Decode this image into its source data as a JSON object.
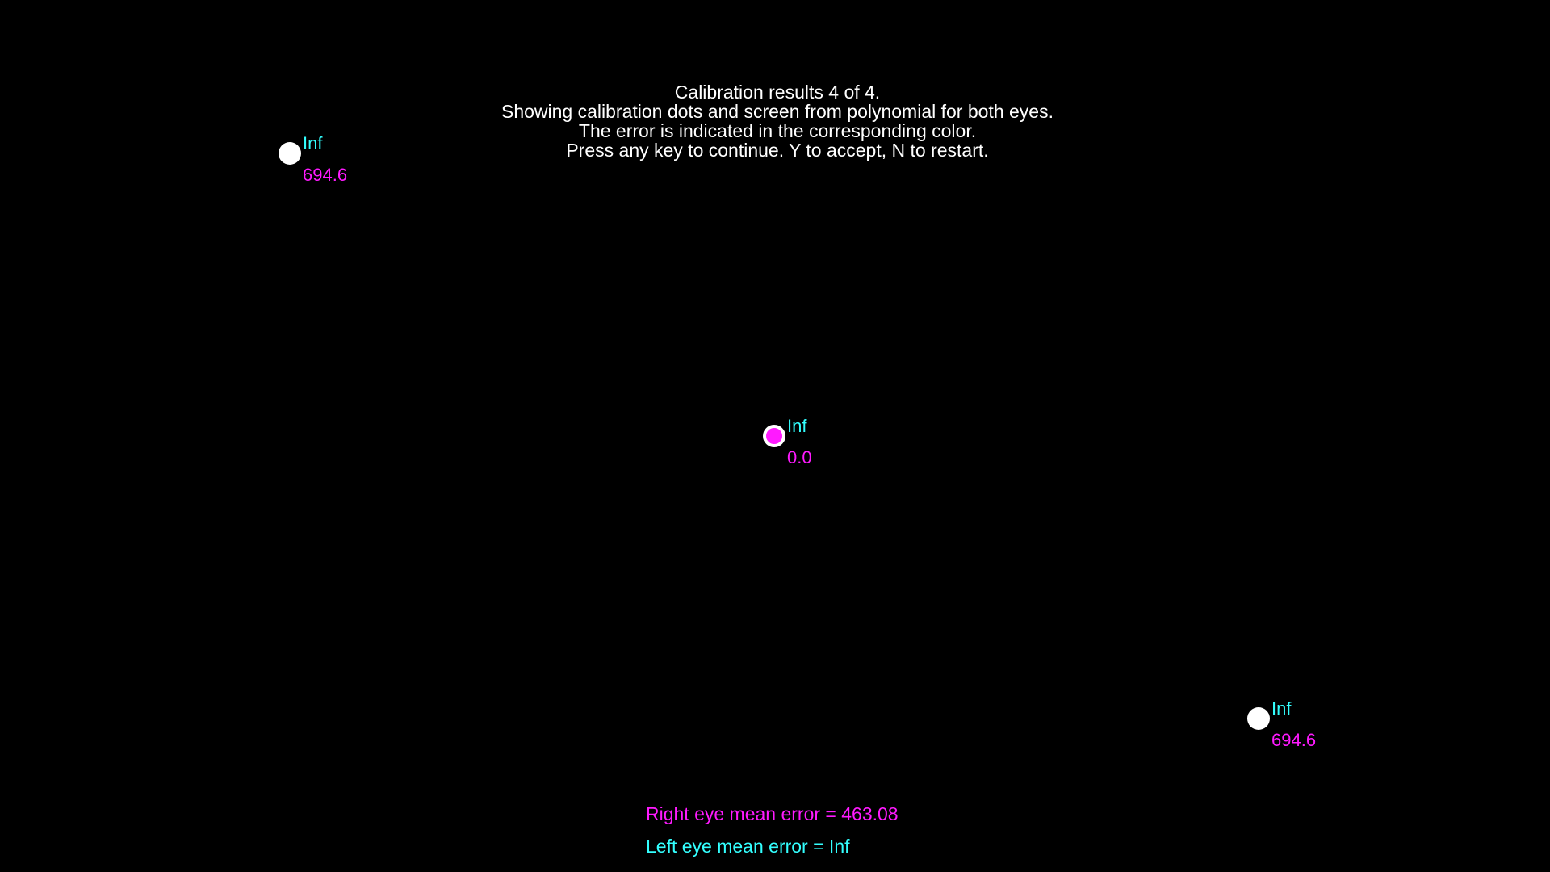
{
  "colors": {
    "background": "#000000",
    "text": "#ffffff",
    "right_eye": "#ff1aff",
    "left_eye": "#33ffff",
    "target_dot": "#ffffff"
  },
  "header": {
    "lines": [
      "Calibration results 4 of 4.",
      "Showing calibration dots and screen from polynomial for both eyes.",
      "The error is indicated in the corresponding color.",
      "Press any key to continue. Y to accept, N to restart."
    ]
  },
  "points": [
    {
      "left_error": "Inf",
      "right_error": "694.6"
    },
    {
      "left_error": "Inf",
      "right_error": "0.0"
    },
    {
      "left_error": "Inf",
      "right_error": "694.6"
    }
  ],
  "summary": {
    "right_eye": "Right eye mean error = 463.08",
    "left_eye": "Left eye mean error  = Inf"
  }
}
